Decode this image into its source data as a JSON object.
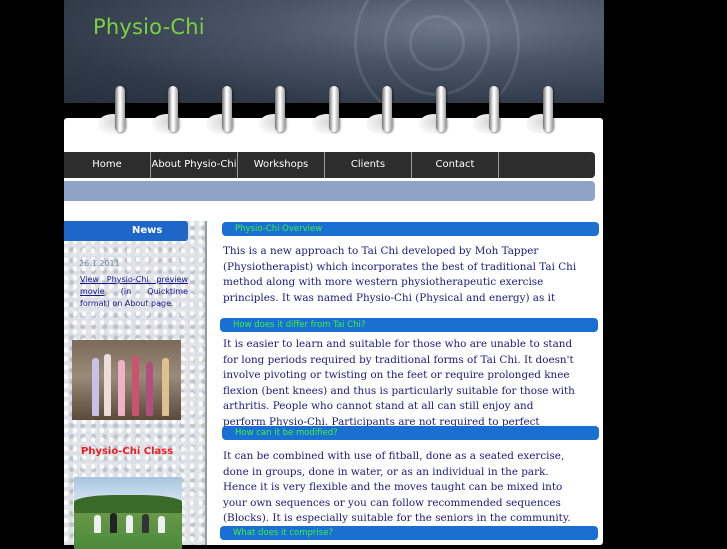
{
  "site": {
    "title": "Physio-Chi"
  },
  "nav": {
    "items": [
      {
        "label": "Home"
      },
      {
        "label": "About Physio-Chi"
      },
      {
        "label": "Workshops"
      },
      {
        "label": "Clients"
      },
      {
        "label": "Contact"
      },
      {
        "label": ""
      }
    ]
  },
  "sidebar": {
    "news_title": "News",
    "date": "26.1.2011",
    "news_link": "View Physio-Chi preview movie",
    "news_rest": " (in Quicktime format) on About page.",
    "class_label": "Physio-Chi Class"
  },
  "sections": [
    {
      "heading": "Physio-Chi Overview",
      "text": "This is a new approach to Tai Chi developed by Moh Tapper (Physiotherapist) which incorporates the best of traditional Tai Chi method along with more western physiotherapeutic exercise principles. It was named Physio-Chi (Physical and energy) as it combines both approaches and the"
    },
    {
      "heading": "How does it differ from Tai Chi?",
      "text": "It is easier to learn and suitable for those who are unable to stand for long periods required by traditional forms of Tai Chi. It doesn't involve pivoting or twisting on the feet or require prolonged knee flexion (bent knees) and thus is particularly suitable for those with arthritis. People who cannot stand at all can still enjoy and perform Physio-Chi. Participants are not required to perfect movements and thus progress quicker. Fun in class is more important."
    },
    {
      "heading": "How can it be modified?",
      "text1": "It can be combined with use of fitball, done as a seated exercise, done in groups, done in water, or as an individual in the park.",
      "text2": "Hence it is very flexible and the moves taught can be mixed into your own sequences or you can follow recommended sequences (Blocks). It is especially suitable for the seniors in the community."
    },
    {
      "heading": "What does it comprise?"
    }
  ]
}
